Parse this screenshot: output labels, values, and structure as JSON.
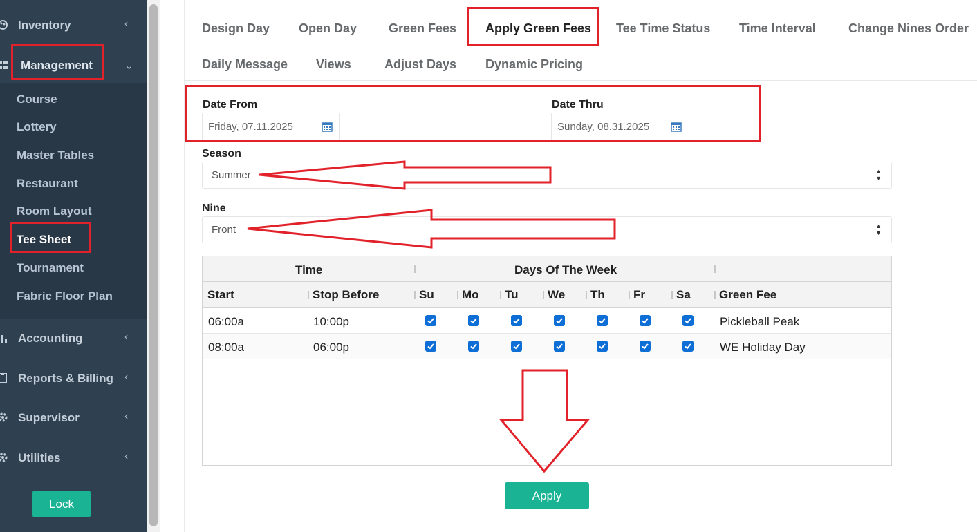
{
  "sidebar": {
    "inventory": {
      "label": "Inventory",
      "icon": "palette-icon"
    },
    "management": {
      "label": "Management",
      "icon": "grid-icon"
    },
    "items": [
      {
        "label": "Course"
      },
      {
        "label": "Lottery"
      },
      {
        "label": "Master Tables"
      },
      {
        "label": "Restaurant"
      },
      {
        "label": "Room Layout"
      },
      {
        "label": "Tee Sheet",
        "active": true
      },
      {
        "label": "Tournament"
      },
      {
        "label": "Fabric Floor Plan"
      }
    ],
    "accounting": {
      "label": "Accounting",
      "icon": "bar-chart-icon"
    },
    "reports": {
      "label": "Reports & Billing",
      "icon": "clipboard-icon"
    },
    "supervisor": {
      "label": "Supervisor",
      "icon": "gear-icon"
    },
    "utilities": {
      "label": "Utilities",
      "icon": "gear-icon"
    },
    "lock_label": "Lock"
  },
  "tabs": {
    "row1": [
      "Design Day",
      "Open Day",
      "Green Fees",
      "Apply Green Fees",
      "Tee Time Status",
      "Time Interval",
      "Change Nines Order"
    ],
    "row2": [
      "Daily Message",
      "Views",
      "Adjust Days",
      "Dynamic Pricing"
    ],
    "active": "Apply Green Fees"
  },
  "form": {
    "date_from": {
      "label": "Date From",
      "value": "Friday, 07.11.2025"
    },
    "date_thru": {
      "label": "Date Thru",
      "value": "Sunday, 08.31.2025"
    },
    "season": {
      "label": "Season",
      "value": "Summer"
    },
    "nine": {
      "label": "Nine",
      "value": "Front"
    }
  },
  "grid": {
    "group_headers": {
      "time": "Time",
      "days": "Days Of The Week"
    },
    "columns": {
      "start": "Start",
      "stop": "Stop Before",
      "su": "Su",
      "mo": "Mo",
      "tu": "Tu",
      "we": "We",
      "th": "Th",
      "fr": "Fr",
      "sa": "Sa",
      "fee": "Green Fee"
    },
    "rows": [
      {
        "start": "06:00a",
        "stop": "10:00p",
        "days": [
          true,
          true,
          true,
          true,
          true,
          true,
          true
        ],
        "fee": "Pickleball Peak"
      },
      {
        "start": "08:00a",
        "stop": "06:00p",
        "days": [
          true,
          true,
          true,
          true,
          true,
          true,
          true
        ],
        "fee": "WE Holiday Day"
      }
    ]
  },
  "apply_label": "Apply",
  "colors": {
    "sidebar": "#2f4050",
    "accent": "#1ab394",
    "annotation": "#e2222b",
    "checkbox": "#0d6ed6"
  }
}
